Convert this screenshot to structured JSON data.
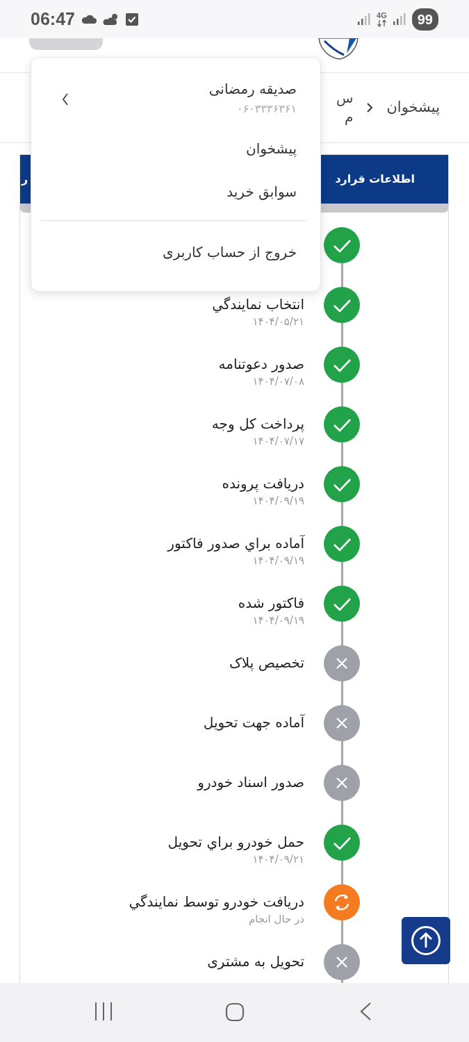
{
  "status_bar": {
    "time": "06:47",
    "network": "4G",
    "battery": "99"
  },
  "breadcrumb": {
    "items": [
      "پیشخوان"
    ],
    "partial_lines": [
      "س",
      "م"
    ]
  },
  "tabs": [
    {
      "label": "اطلاعات قرارد"
    },
    {
      "label": "ر"
    }
  ],
  "user_menu": {
    "name": "صدیقه رمضانی",
    "phone": "۰۶۰۳۳۳۶۳۶۱",
    "items": [
      {
        "label": "پیشخوان",
        "divider_before": false
      },
      {
        "label": "سوابق خرید",
        "divider_before": false
      },
      {
        "label": "خروج از حساب کاربری",
        "divider_before": true
      }
    ]
  },
  "timeline": [
    {
      "kind": "done"
    },
    {
      "kind": "done",
      "title": "انتخاب نمايندگي",
      "date": "۱۴۰۴/۰۵/۲۱"
    },
    {
      "kind": "done",
      "title": "صدور دعوتنامه",
      "date": "۱۴۰۴/۰۷/۰۸"
    },
    {
      "kind": "done",
      "title": "پرداخت کل وجه",
      "date": "۱۴۰۴/۰۷/۱۷"
    },
    {
      "kind": "done",
      "title": "دریافت پرونده",
      "date": "۱۴۰۴/۰۹/۱۹"
    },
    {
      "kind": "done",
      "title": "آماده براي صدور فاکتور",
      "date": "۱۴۰۴/۰۹/۱۹"
    },
    {
      "kind": "done",
      "title": "فاکتور شده",
      "date": "۱۴۰۴/۰۹/۱۹"
    },
    {
      "kind": "pending",
      "title": "تخصیص پلاک"
    },
    {
      "kind": "pending",
      "title": "آماده جهت تحویل"
    },
    {
      "kind": "pending",
      "title": "صدور اسناد خودرو"
    },
    {
      "kind": "done",
      "title": "حمل خودرو براي تحویل",
      "date": "۱۴۰۴/۰۹/۲۱"
    },
    {
      "kind": "in_progress",
      "title": "دریافت خودرو توسط نمایندگي",
      "date": "در حال انجام"
    },
    {
      "kind": "pending",
      "title": "تحویل به مشتری"
    }
  ]
}
